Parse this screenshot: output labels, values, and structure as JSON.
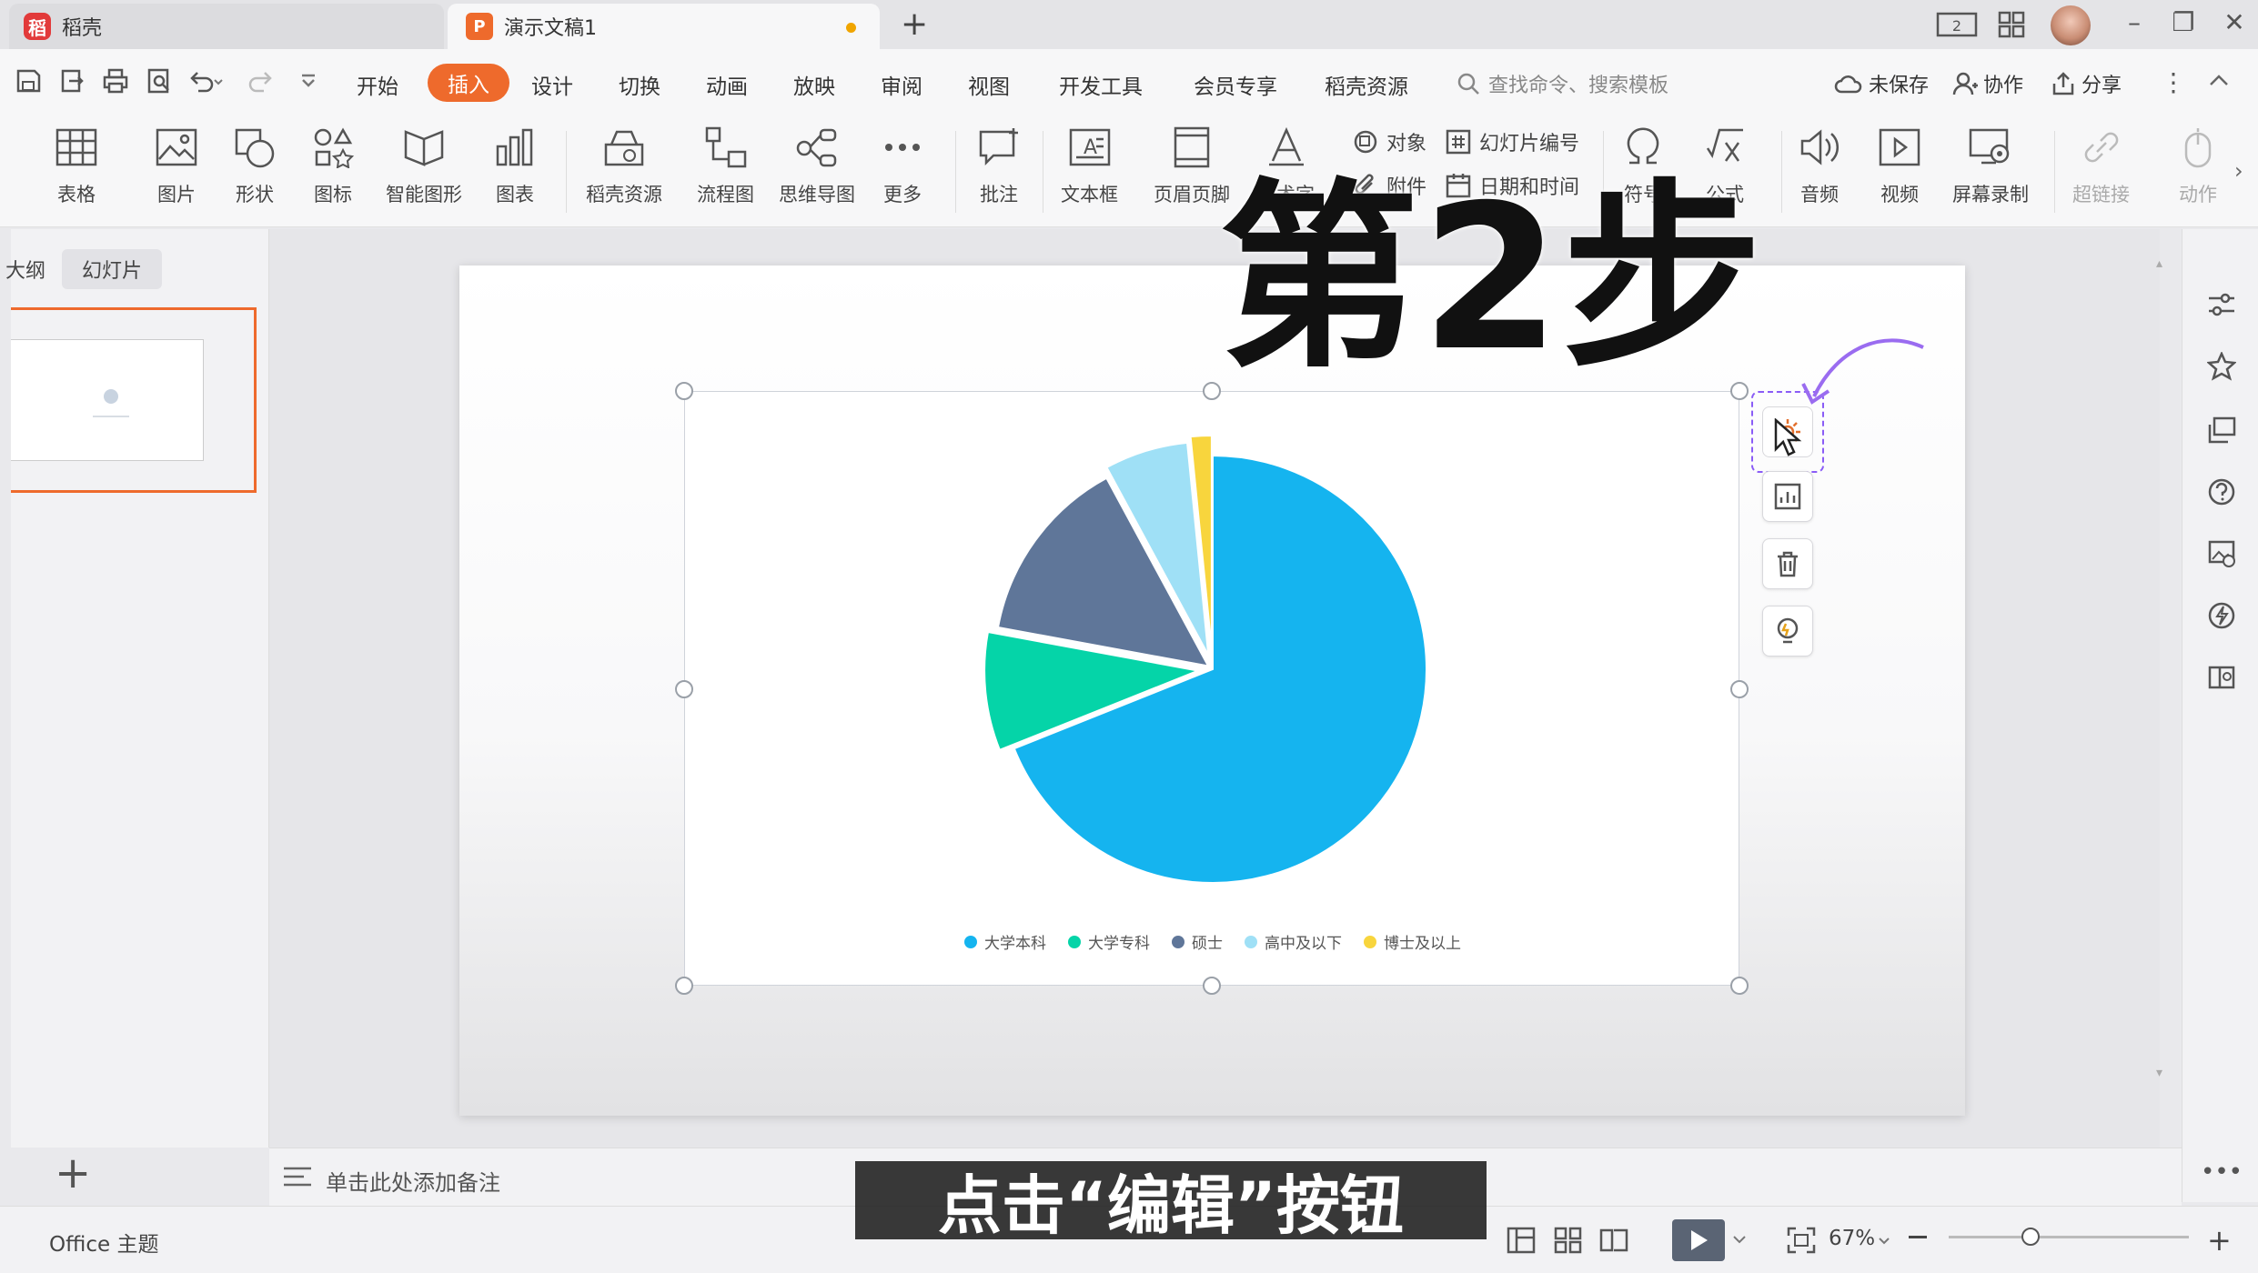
{
  "tabs": {
    "home": "稻壳",
    "document": "演示文稿1",
    "add": "+"
  },
  "window": {
    "minimize": "–",
    "restore": "❐",
    "close": "✕"
  },
  "menu": {
    "tabs": [
      "开始",
      "插入",
      "设计",
      "切换",
      "动画",
      "放映",
      "审阅",
      "视图",
      "开发工具",
      "会员专享",
      "稻壳资源"
    ],
    "active": "插入",
    "search_placeholder": "查找命令、搜索模板",
    "unsaved": "未保存",
    "collaborate": "协作",
    "share": "分享"
  },
  "toolbar": {
    "table": "表格",
    "picture": "图片",
    "shape": "形状",
    "icon": "图标",
    "smartart": "智能图形",
    "chart": "图表",
    "docer_resources": "稻壳资源",
    "flowchart": "流程图",
    "mindmap": "思维导图",
    "more": "更多",
    "comment": "批注",
    "textbox": "文本框",
    "header_footer": "页眉页脚",
    "wordart": "艺术字",
    "object": "对象",
    "slide_number": "幻灯片编号",
    "attachment": "附件",
    "datetime": "日期和时间",
    "symbol": "符号",
    "formula": "公式",
    "audio": "音频",
    "video": "视频",
    "screen_record": "屏幕录制",
    "hyperlink": "超链接",
    "action": "动作"
  },
  "left_panel": {
    "tab_outline": "大纲",
    "tab_slides": "幻灯片",
    "add_slide": "+"
  },
  "notes": {
    "placeholder": "单击此处添加备注"
  },
  "status": {
    "theme": "Office 主题",
    "zoom": "67%"
  },
  "overlay": {
    "step_title": "第2步",
    "caption": "点击“编辑”按钮"
  },
  "colors": {
    "accent": "#ee6a2c",
    "selection": "#8a5cf6"
  },
  "chart_data": {
    "type": "pie",
    "categories": [
      "大学本科",
      "大学专科",
      "硕士",
      "高中及以下",
      "博士及以上"
    ],
    "values": [
      65.5,
      8.5,
      13.5,
      6,
      1.5
    ],
    "colors": [
      "#15b4ef",
      "#05d4a8",
      "#5f7699",
      "#9fe0f6",
      "#f8d53d"
    ],
    "legend": "bottom",
    "exploded": true
  }
}
